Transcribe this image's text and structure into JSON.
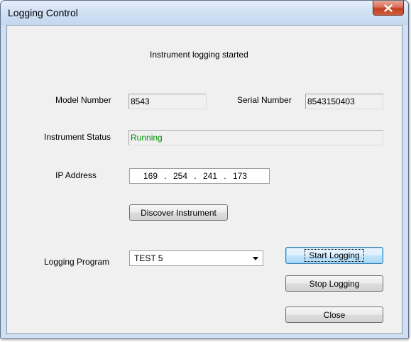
{
  "window": {
    "title": "Logging Control"
  },
  "message": "Instrument logging started",
  "model": {
    "label": "Model Number",
    "value": "8543"
  },
  "serial": {
    "label": "Serial Number",
    "value": "8543150403"
  },
  "status": {
    "label": "Instrument Status",
    "value": "Running",
    "color": "#009000"
  },
  "ip": {
    "label": "IP Address",
    "octets": [
      "169",
      "254",
      "241",
      "173"
    ],
    "separator": "."
  },
  "buttons": {
    "discover": "Discover Instrument",
    "start": "Start Logging",
    "stop": "Stop Logging",
    "close": "Close"
  },
  "program": {
    "label": "Logging Program",
    "selected": "TEST 5"
  },
  "icons": {
    "close": "close-icon",
    "dropdown": "chevron-down-icon"
  }
}
